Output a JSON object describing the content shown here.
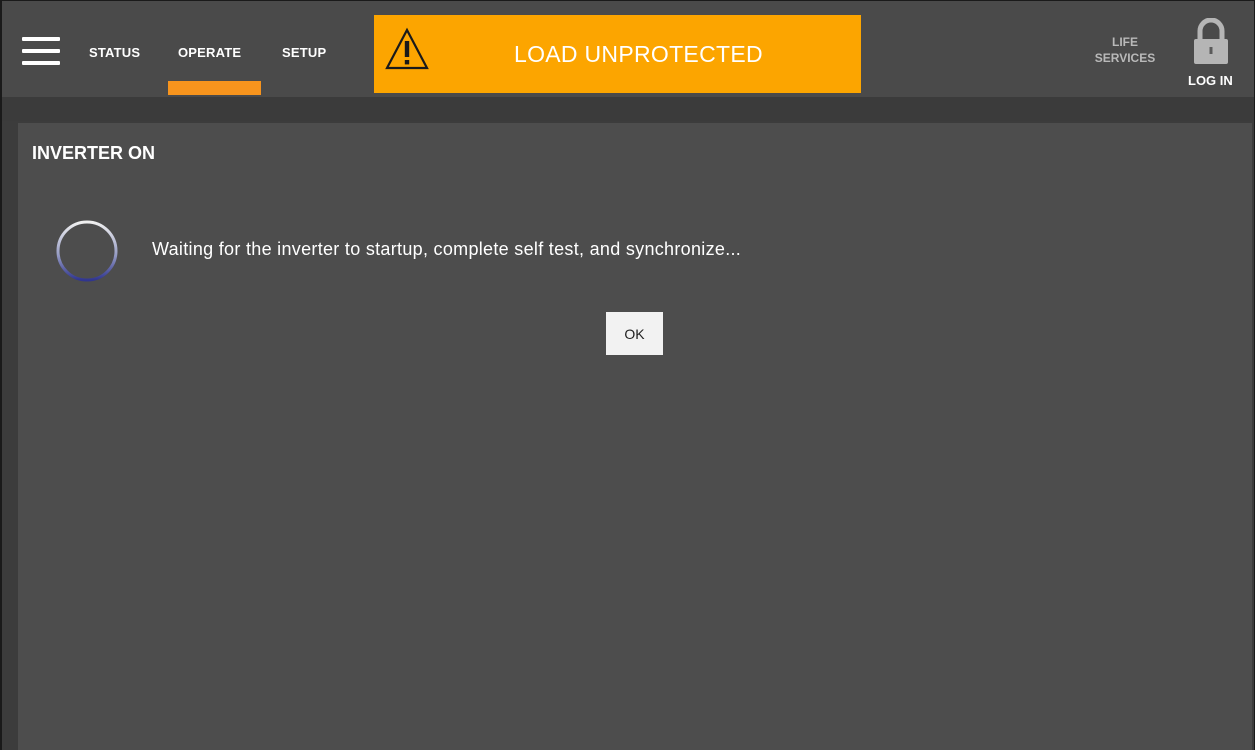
{
  "nav": {
    "tabs": [
      {
        "label": "STATUS"
      },
      {
        "label": "OPERATE"
      },
      {
        "label": "SETUP"
      }
    ],
    "active_tab": "OPERATE"
  },
  "alarm": {
    "text": "LOAD UNPROTECTED",
    "icon": "warning-icon",
    "color": "#fca500"
  },
  "header_right": {
    "life_services_label": "LIFE\nSERVICES",
    "login_label": "LOG IN",
    "login_icon": "lock-icon"
  },
  "panel": {
    "title": "INVERTER ON",
    "message": "Waiting for the inverter to startup, complete self test, and synchronize...",
    "ok_label": "OK",
    "spinner_icon": "loading-spinner-icon"
  },
  "colors": {
    "accent": "#f7941d",
    "header_bg": "#4a4a4a",
    "panel_bg": "#4d4d4d"
  }
}
